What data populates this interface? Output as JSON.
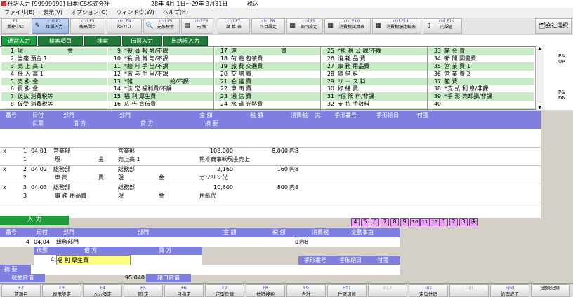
{
  "title_bar": {
    "text": "仕訳入力 [99999999] 日本ICS株式会社",
    "period": "28年 4月 1日～29年 3月31日",
    "tax_mode": "税込"
  },
  "menu": [
    "ファイル(E)",
    "表示(V)",
    "オプション(O)",
    "ウィンドウ(W)",
    "ヘルプ(H)"
  ],
  "toolbar": [
    {
      "key": "F1",
      "label": "業務中止"
    },
    {
      "key": "ctrl F2",
      "label": "仕訳入力"
    },
    {
      "key": "ctrl F3",
      "label": "残高問合"
    },
    {
      "key": "ctrl F4",
      "label": "ﾁｪｯｸﾘｽﾄ"
    },
    {
      "key": "ctrl F5",
      "label": "元帳検索"
    },
    {
      "key": "ctrl F6",
      "label": "元 帳"
    },
    {
      "key": "ctrl F7",
      "label": "試 算 表"
    },
    {
      "key": "ctrl F8",
      "label": "科目設定"
    },
    {
      "key": "ctrl F9",
      "label": "部門設定"
    },
    {
      "key": "ctrl F10",
      "label": "消費税試算表"
    },
    {
      "key": "ctrl F11",
      "label": "消費税額比較表"
    },
    {
      "key": "ctrl F12",
      "label": "内訳書"
    }
  ],
  "company_select": "会社選択",
  "tabs": [
    "通常入力",
    "検索項目",
    "検索",
    "伝票入力",
    "出納帳入力"
  ],
  "accounts": [
    [
      [
        "1",
        "現",
        "金"
      ],
      [
        "2",
        "当座 預金 1",
        ""
      ],
      [
        "3",
        "売 上 高 1",
        ""
      ],
      [
        "4",
        "仕 入 高 1",
        ""
      ],
      [
        "5",
        "売 掛 金",
        ""
      ],
      [
        "6",
        "買 掛 金",
        ""
      ],
      [
        "7",
        "仮払 消費税等",
        ""
      ],
      [
        "8",
        "仮受 消費税等",
        ""
      ]
    ],
    [
      [
        "9",
        "*役 員 報 酬/不課",
        ""
      ],
      [
        "10",
        "*役 員 賞 与/不課",
        ""
      ],
      [
        "11",
        "*給 料 手 当/不課",
        ""
      ],
      [
        "12",
        "*賞 与 手 当/不課",
        ""
      ],
      [
        "13",
        "*雑",
        "給/不課"
      ],
      [
        "14",
        "*法 定 福利費/不課",
        ""
      ],
      [
        "15",
        "福 利 厚生費",
        ""
      ],
      [
        "16",
        "広 告 宣伝費",
        ""
      ]
    ],
    [
      [
        "17",
        "運",
        "賃"
      ],
      [
        "18",
        "荷 造 包装費",
        ""
      ],
      [
        "19",
        "旅 費 交通費",
        ""
      ],
      [
        "20",
        "交 際 費",
        ""
      ],
      [
        "21",
        "会 議 費",
        ""
      ],
      [
        "22",
        "車 両 費",
        ""
      ],
      [
        "23",
        "通 信 費",
        ""
      ],
      [
        "24",
        "水 道 光熱費",
        ""
      ]
    ],
    [
      [
        "25",
        "*租 税 公 課/不課",
        ""
      ],
      [
        "26",
        "消 耗 品 費",
        ""
      ],
      [
        "27",
        "事 務 用品費",
        ""
      ],
      [
        "28",
        "賃 借 料",
        ""
      ],
      [
        "29",
        "リ ー ス 料",
        ""
      ],
      [
        "30",
        "修 繕 費",
        ""
      ],
      [
        "31",
        "*保 険 料/非課",
        ""
      ],
      [
        "32",
        "支 払 手数料",
        ""
      ]
    ],
    [
      [
        "33",
        "諸 会 費",
        ""
      ],
      [
        "34",
        "新 聞 図書費",
        ""
      ],
      [
        "35",
        "営 業 費 1",
        ""
      ],
      [
        "36",
        "営 業 費 2",
        ""
      ],
      [
        "37",
        "雑 費",
        ""
      ],
      [
        "38",
        "*支 払 利 息/非課",
        ""
      ],
      [
        "39",
        "*手 形 売却損/非課",
        ""
      ],
      [
        "40",
        "",
        ""
      ]
    ]
  ],
  "page_nav": {
    "up": "P& UP",
    "down": "P& DN"
  },
  "grid_header": {
    "row1": [
      "番号",
      "日付",
      "部門",
      "部門",
      "金 額",
      "税 額",
      "消費税",
      "実.",
      "手形番号",
      "手形期日",
      "付箋"
    ],
    "row2": [
      "伝票",
      "借 方",
      "貸 方",
      "摘 要"
    ]
  },
  "entries": [
    {
      "mark": "x",
      "no": "1",
      "date": "04.01",
      "dept_dr": "営業部",
      "dept_cr": "営業部",
      "amount": "108,000",
      "tax": "8,000",
      "tax_type": "内8",
      "slip": "1",
      "debit": "現",
      "debit2": "金",
      "credit": "売上高 1",
      "memo": "熊本商事㈱現金売上"
    },
    {
      "mark": "x",
      "no": "2",
      "date": "04.02",
      "dept_dr": "総務部",
      "dept_cr": "総務部",
      "amount": "2,160",
      "tax": "160",
      "tax_type": "内8",
      "slip": "2",
      "debit": "車 両",
      "debit2": "費",
      "credit": "現",
      "credit2": "金",
      "memo": "ガソリン代"
    },
    {
      "mark": "x",
      "no": "3",
      "date": "04.03",
      "dept_dr": "総務部",
      "dept_cr": "総務部",
      "amount": "10,800",
      "tax": "800",
      "tax_type": "内8",
      "slip": "3",
      "debit": "事 務 用品費",
      "debit2": "",
      "credit": "現",
      "credit2": "金",
      "memo": "用紙代"
    }
  ],
  "input_label": "入 力",
  "month_buttons": [
    "4",
    "5",
    "6",
    "7",
    "8",
    "9",
    "10",
    "11",
    "12",
    "1",
    "2",
    "3",
    "決"
  ],
  "input_header": [
    "番号",
    "日付",
    "部門",
    "部門",
    "金 額",
    "税 額",
    "消費税",
    "変動事由"
  ],
  "input_row": {
    "no": "4",
    "date": "04.04",
    "dept": "総務部門",
    "tax": "0",
    "tax_type": "内8"
  },
  "input_header2": [
    "伝票",
    "借 方",
    "貸 方"
  ],
  "input_row2": {
    "slip": "4",
    "debit": "福 利 厚生費"
  },
  "input_header3": [
    "手形番号",
    "手形期日",
    "付箋"
  ],
  "tekiyo_label": "摘 要",
  "cash_balance": {
    "label": "現金貸借",
    "value": "95,040",
    "label2": "諸口貸借"
  },
  "fkeys": [
    {
      "key": "F2",
      "label": "前項目",
      "dis": false
    },
    {
      "key": "F3",
      "label": "表示設定",
      "dis": false
    },
    {
      "key": "F4",
      "label": "入力設定",
      "dis": false
    },
    {
      "key": "F5",
      "label": "固 定",
      "dis": false
    },
    {
      "key": "F6",
      "label": "月指定",
      "dis": false
    },
    {
      "key": "F7",
      "label": "定型登録",
      "dis": false
    },
    {
      "key": "F8",
      "label": "仕訳検索",
      "dis": false
    },
    {
      "key": "F9",
      "label": "合計",
      "dis": false
    },
    {
      "key": "F11",
      "label": "仕訳切替",
      "dis": false
    },
    {
      "key": "F12",
      "label": "",
      "dis": true
    },
    {
      "key": "Ins",
      "label": "定型仕訳",
      "dis": false
    },
    {
      "key": "Del",
      "label": "",
      "dis": true
    },
    {
      "key": "End",
      "label": "処理終了",
      "dis": false
    },
    {
      "key": "",
      "label": "連続記録",
      "dis": false
    }
  ]
}
